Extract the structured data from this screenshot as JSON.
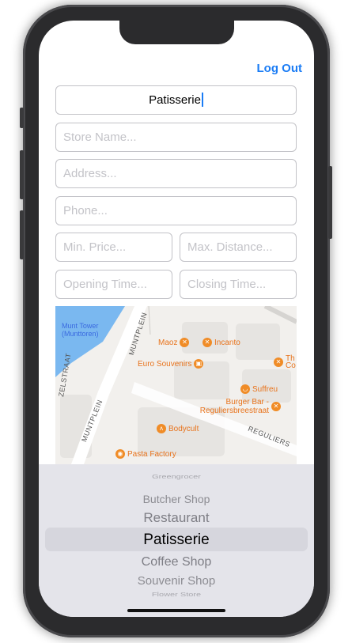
{
  "header": {
    "logout_label": "Log Out"
  },
  "form": {
    "category_value": "Patisserie",
    "store_name_placeholder": "Store Name...",
    "address_placeholder": "Address...",
    "phone_placeholder": "Phone...",
    "min_price_placeholder": "Min. Price...",
    "max_distance_placeholder": "Max. Distance...",
    "opening_time_placeholder": "Opening Time...",
    "closing_time_placeholder": "Closing Time..."
  },
  "map": {
    "water_label": "Munt Tower (Munttoren)",
    "streets": [
      "MUNTPLEIN",
      "MUNTPLEIN",
      "ZELSTRAAT",
      "REGULIERS"
    ],
    "pois": [
      {
        "label": "Maoz",
        "icon": "fork-knife-icon"
      },
      {
        "label": "Incanto",
        "icon": "fork-knife-icon"
      },
      {
        "label": "Euro Souvenirs",
        "icon": "shopping-bag-icon"
      },
      {
        "label": "Th Co",
        "icon": "fork-knife-icon"
      },
      {
        "label": "Suffreu",
        "icon": "coffee-cup-icon"
      },
      {
        "label": "Burger Bar - Reguliersbreestraat",
        "icon": "fork-knife-icon"
      },
      {
        "label": "Bodycult",
        "icon": "dumbbell-icon"
      },
      {
        "label": "Pasta Factory",
        "icon": "pasta-icon"
      }
    ]
  },
  "picker": {
    "items": [
      "Greengrocer",
      "Butcher Shop",
      "Restaurant",
      "Patisserie",
      "Coffee Shop",
      "Souvenir Shop",
      "Flower Store"
    ],
    "selected": "Patisserie"
  },
  "colors": {
    "accent": "#1a7cf5",
    "poi": "#e8731c",
    "water": "#7ab8f0"
  }
}
